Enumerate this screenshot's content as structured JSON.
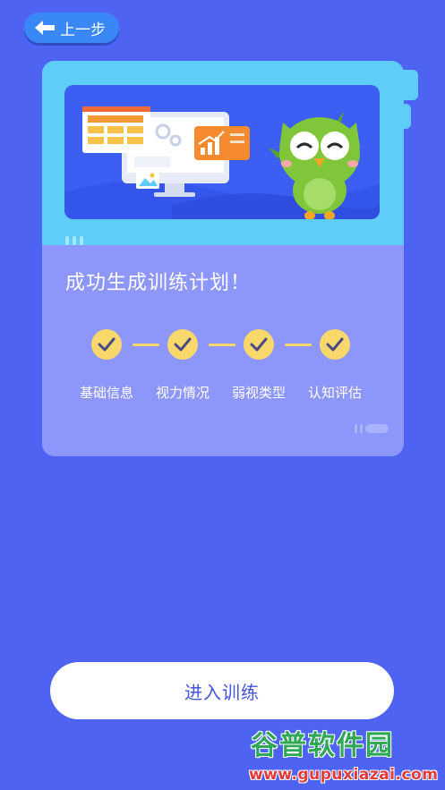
{
  "header": {
    "back_label": "上一步"
  },
  "card": {
    "title": "成功生成训练计划！",
    "steps": [
      {
        "label": "基础信息",
        "completed": true
      },
      {
        "label": "视力情况",
        "completed": true
      },
      {
        "label": "弱视类型",
        "completed": true
      },
      {
        "label": "认知评估",
        "completed": true
      }
    ]
  },
  "action": {
    "enter_label": "进入训练"
  },
  "watermark": {
    "title": "谷普软件园",
    "url": "www.gupuxiazai.com"
  },
  "colors": {
    "background": "#4f63f2",
    "card_header": "#5ecdf9",
    "card_body": "#8d97fb",
    "check": "#f8d86a",
    "owl": "#7fc63a"
  }
}
